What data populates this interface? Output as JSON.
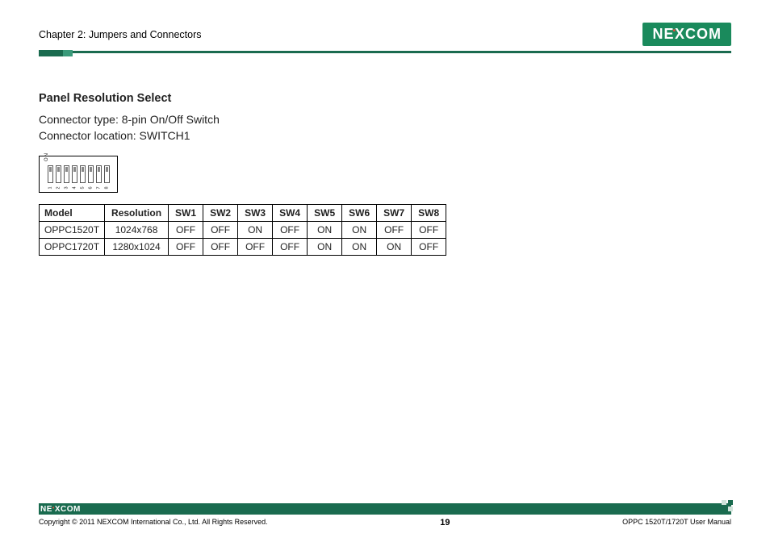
{
  "header": {
    "chapter": "Chapter 2: Jumpers and Connectors",
    "logo_text_1": "NE",
    "logo_text_x": "X",
    "logo_text_2": "COM"
  },
  "section": {
    "title": "Panel Resolution Select",
    "connector_type": "Connector type: 8-pin On/Off Switch",
    "connector_location": "Connector location: SWITCH1"
  },
  "dip": {
    "on_label": "ON",
    "numbers": [
      "1",
      "2",
      "3",
      "4",
      "5",
      "6",
      "7",
      "8"
    ]
  },
  "table": {
    "headers": [
      "Model",
      "Resolution",
      "SW1",
      "SW2",
      "SW3",
      "SW4",
      "SW5",
      "SW6",
      "SW7",
      "SW8"
    ],
    "rows": [
      [
        "OPPC1520T",
        "1024x768",
        "OFF",
        "OFF",
        "ON",
        "OFF",
        "ON",
        "ON",
        "OFF",
        "OFF"
      ],
      [
        "OPPC1720T",
        "1280x1024",
        "OFF",
        "OFF",
        "OFF",
        "OFF",
        "ON",
        "ON",
        "ON",
        "OFF"
      ]
    ]
  },
  "footer": {
    "logo_text_1": "NE",
    "logo_text_x": "X",
    "logo_text_2": "COM",
    "copyright": "Copyright © 2011 NEXCOM International Co., Ltd. All Rights Reserved.",
    "page_number": "19",
    "manual": "OPPC 1520T/1720T User Manual"
  }
}
